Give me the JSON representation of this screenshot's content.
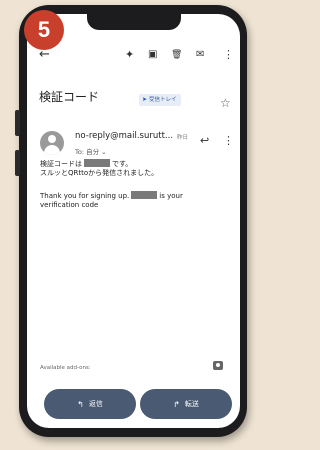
{
  "step_number": "5",
  "topbar": {
    "back_icon": "←",
    "sparkle_icon": "✦",
    "archive_icon": "▣",
    "delete_icon": "🗑",
    "mail_icon": "✉",
    "more_icon": "⋮"
  },
  "subject": "検証コード",
  "label_chip": "受信トレイ",
  "sender": {
    "address": "no-reply@mail.surutt...",
    "time": "昨日",
    "to": "To: 自分 ⌄"
  },
  "body": {
    "line1_a": "検証コードは",
    "line1_b": "です。",
    "line2": "スルッとQRttoから発信されました。",
    "line3_a": "Thank you for signing up.",
    "line3_b": "is your",
    "line4": "verification code"
  },
  "addons_label": "Available add-ons:",
  "buttons": {
    "reply": "返信",
    "forward": "転送"
  }
}
